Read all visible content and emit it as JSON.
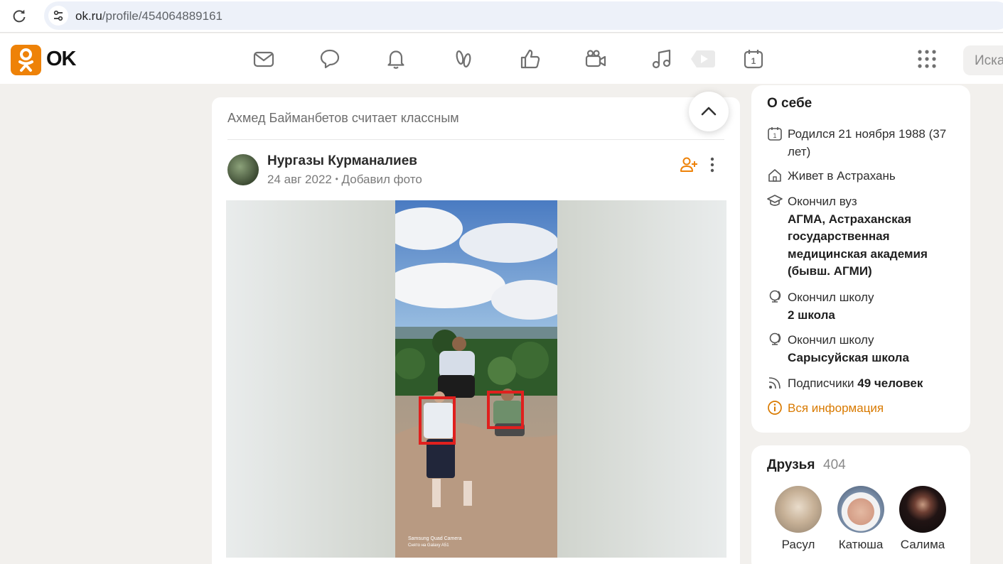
{
  "browser": {
    "url_host": "ok.ru",
    "url_path": "/profile/454064889161",
    "reload_icon": "reload-icon",
    "site_info_icon": "tune-icon"
  },
  "header": {
    "logo_text": "OK",
    "brand_color": "#ee8208",
    "nav_icons": [
      "mail-icon",
      "chat-icon",
      "bell-icon",
      "guests-icon",
      "like-icon",
      "video-camera-icon",
      "music-icon",
      "video-icon",
      "calendar-icon"
    ],
    "apps_icon": "grid-icon",
    "search_placeholder": "Иска"
  },
  "feed": {
    "liked_by": "Ахмед Байманбетов считает классным",
    "post": {
      "author": "Нургазы Курманалиев",
      "date": "24 авг 2022",
      "separator": "•",
      "action": "Добавил фото",
      "photo_caption": "Samsung Quad Camera\nСнято на Galaxy A51"
    }
  },
  "about": {
    "title": "О себе",
    "birth": "Родился 21 ноября 1988 (37 лет)",
    "city": "Живет в Астрахань",
    "university_label": "Окончил вуз",
    "university_name": "АГМА, Астраханская государственная медицинская академия (бывш. АГМИ)",
    "school1_label": "Окончил школу",
    "school1_name": "2 школа",
    "school2_label": "Окончил школу",
    "school2_name": "Сарысуйская школа",
    "subscribers_label": "Подписчики",
    "subscribers_value": "49 человек",
    "all_info": "Вся информация",
    "accent_color": "#d97a00"
  },
  "friends": {
    "title": "Друзья",
    "count": "404",
    "items": [
      {
        "name": "Расул"
      },
      {
        "name": "Катюша"
      },
      {
        "name": "Салима"
      }
    ]
  }
}
